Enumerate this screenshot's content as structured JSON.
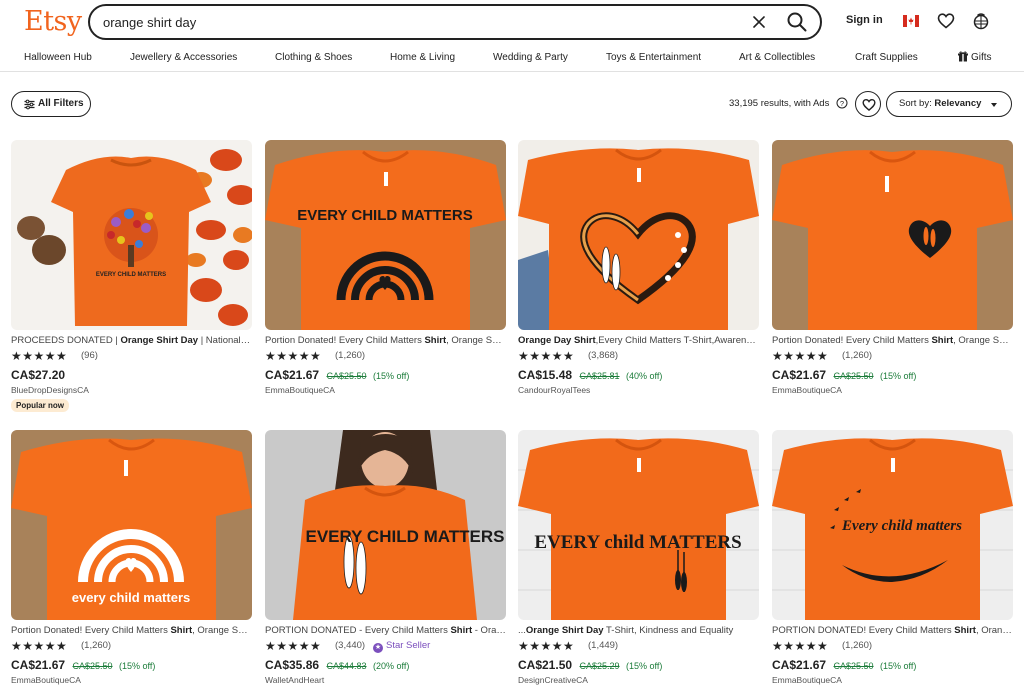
{
  "header": {
    "logo": "Etsy",
    "search_value": "orange shirt day",
    "sign_in": "Sign in"
  },
  "nav": {
    "items": [
      "Halloween Hub",
      "Jewellery & Accessories",
      "Clothing & Shoes",
      "Home & Living",
      "Wedding & Party",
      "Toys & Entertainment",
      "Art & Collectibles",
      "Craft Supplies",
      "Gifts"
    ]
  },
  "toolbar": {
    "filters_label": "All Filters",
    "results": "33,195 results, with Ads",
    "sort_prefix": "Sort by:",
    "sort_value": "Relevancy"
  },
  "listings": [
    {
      "title_pre": "PROCEEDS DONATED | ",
      "title_bold": "Orange Shirt Day",
      "title_post": " | National Day for Truth and Reconciliation",
      "stars": "★★★★★",
      "reviews": "(96)",
      "price": "CA$27.20",
      "original_price": "",
      "discount": "",
      "shop": "BlueDropDesignsCA",
      "badge": "Popular now",
      "star_seller": "",
      "shirt_text": "EVERY CHILD MATTERS"
    },
    {
      "title_pre": "Portion Donated! Every Child Matters ",
      "title_bold": "Shirt",
      "title_post": ", Orange Shirt Day",
      "stars": "★★★★★",
      "reviews": "(1,260)",
      "price": "CA$21.67",
      "original_price": "CA$25.50",
      "discount": "(15% off)",
      "shop": "EmmaBoutiqueCA",
      "badge": "",
      "star_seller": "",
      "shirt_text": "EVERY CHILD MATTERS"
    },
    {
      "title_pre": "",
      "title_bold": "Orange Day Shirt",
      "title_post": ",Every Child Matters T-Shirt,Awareness",
      "stars": "★★★★★",
      "reviews": "(3,868)",
      "price": "CA$15.48",
      "original_price": "CA$25.81",
      "discount": "(40% off)",
      "shop": "CandourRoyalTees",
      "badge": "",
      "star_seller": "",
      "shirt_text": ""
    },
    {
      "title_pre": "Portion Donated! Every Child Matters ",
      "title_bold": "Shirt",
      "title_post": ", Orange Shirt Day",
      "stars": "★★★★★",
      "reviews": "(1,260)",
      "price": "CA$21.67",
      "original_price": "CA$25.50",
      "discount": "(15% off)",
      "shop": "EmmaBoutiqueCA",
      "badge": "",
      "star_seller": "",
      "shirt_text": ""
    },
    {
      "title_pre": "Portion Donated! Every Child Matters ",
      "title_bold": "Shirt",
      "title_post": ", Orange Shirt Day",
      "stars": "★★★★★",
      "reviews": "(1,260)",
      "price": "CA$21.67",
      "original_price": "CA$25.50",
      "discount": "(15% off)",
      "shop": "EmmaBoutiqueCA",
      "badge": "",
      "star_seller": "",
      "shirt_text": "every child matters"
    },
    {
      "title_pre": "PORTION DONATED - Every Child Matters ",
      "title_bold": "Shirt",
      "title_post": " - Orange Shirt Day",
      "stars": "★★★★★",
      "reviews": "(3,440)",
      "price": "CA$35.86",
      "original_price": "CA$44.83",
      "discount": "(20% off)",
      "shop": "WalletAndHeart",
      "badge": "",
      "star_seller": "Star Seller",
      "shirt_text": "EVERY CHILD MATTERS"
    },
    {
      "title_pre": "...",
      "title_bold": "Orange Shirt Day",
      "title_post": " T-Shirt, Kindness and Equality",
      "stars": "★★★★★",
      "reviews": "(1,449)",
      "price": "CA$21.50",
      "original_price": "CA$25.29",
      "discount": "(15% off)",
      "shop": "DesignCreativeCA",
      "badge": "",
      "star_seller": "",
      "shirt_text": "EVERY child MATTERS"
    },
    {
      "title_pre": "PORTION DONATED! Every Child Matters ",
      "title_bold": "Shirt",
      "title_post": ", Orange Shirt Day",
      "stars": "★★★★★",
      "reviews": "(1,260)",
      "price": "CA$21.67",
      "original_price": "CA$25.50",
      "discount": "(15% off)",
      "shop": "EmmaBoutiqueCA",
      "badge": "",
      "star_seller": "",
      "shirt_text": "Every child matters"
    }
  ],
  "colors": {
    "brand": "#f1641e",
    "shirt_orange": "#f26a1b",
    "discount_green": "#1c7c3a",
    "star_seller_purple": "#7b4fbd"
  }
}
